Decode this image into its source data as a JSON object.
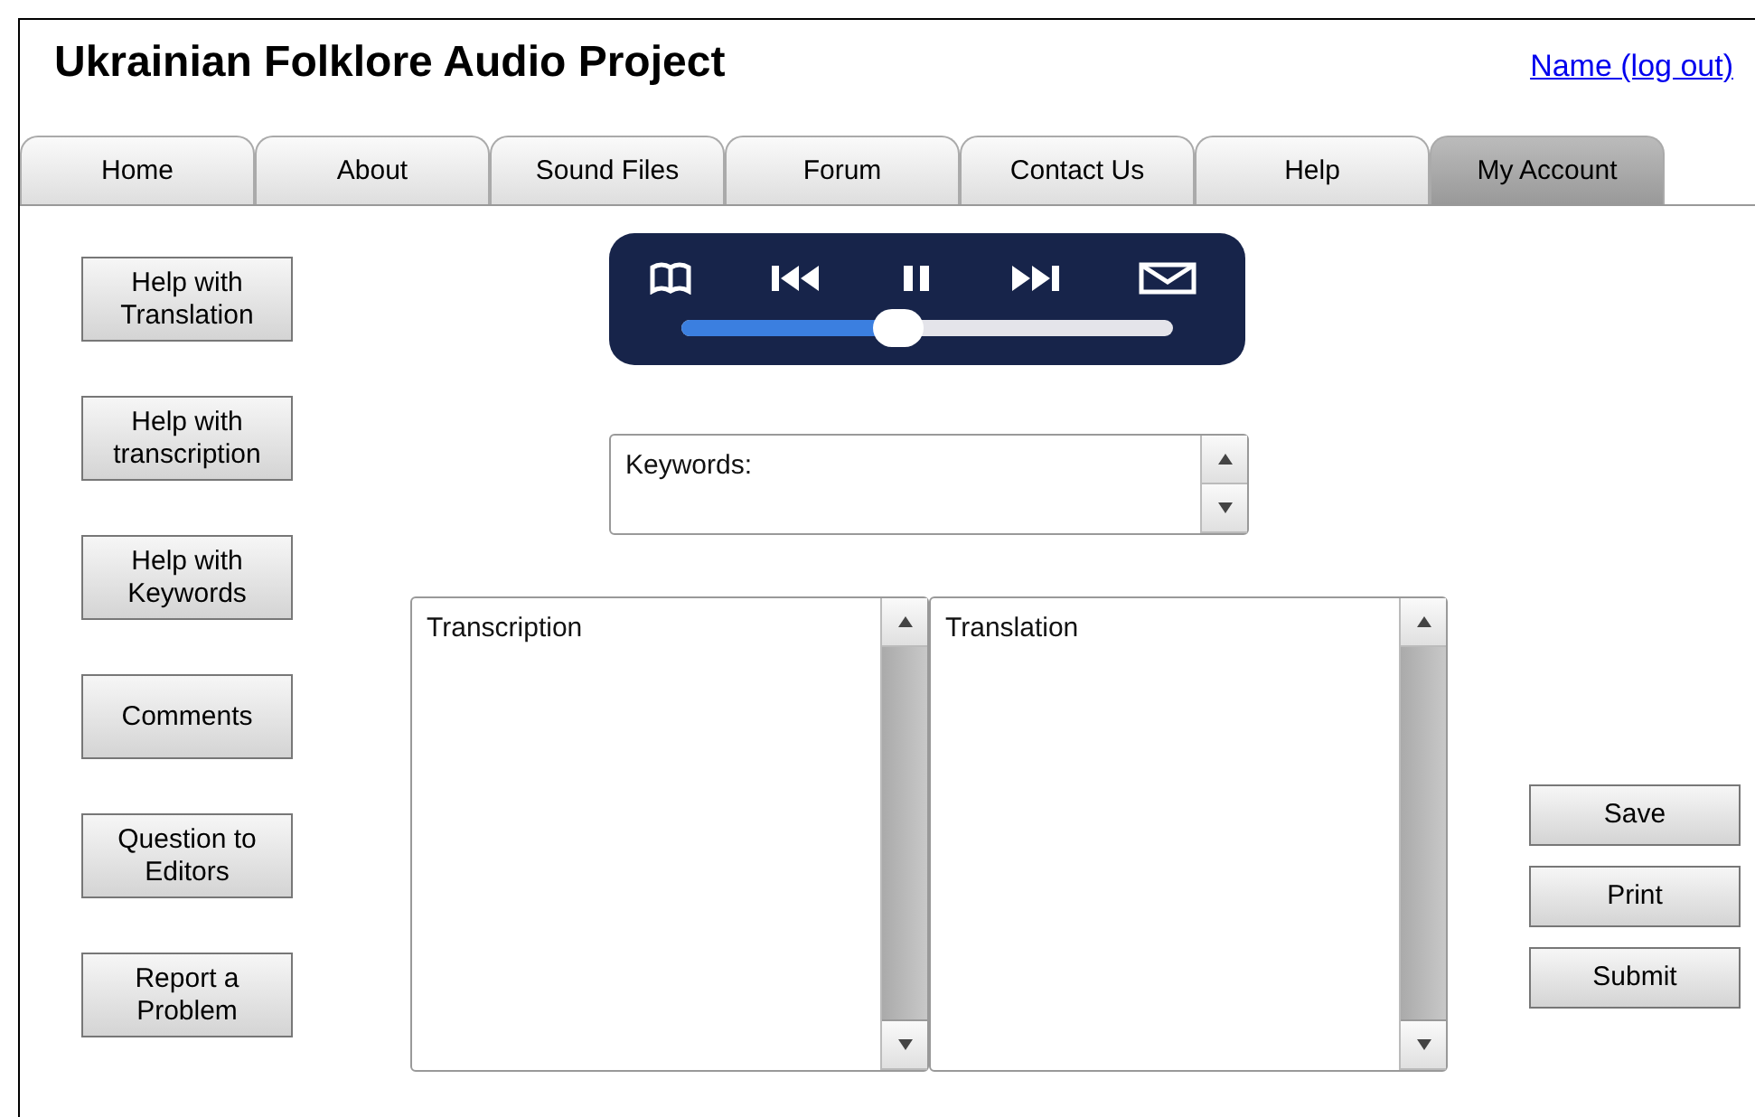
{
  "header": {
    "title": "Ukrainian Folklore Audio Project",
    "user_link": "Name (log out)"
  },
  "tabs": [
    {
      "label": "Home",
      "selected": false
    },
    {
      "label": "About",
      "selected": false
    },
    {
      "label": "Sound Files",
      "selected": false
    },
    {
      "label": "Forum",
      "selected": false
    },
    {
      "label": "Contact Us",
      "selected": false
    },
    {
      "label": "Help",
      "selected": false
    },
    {
      "label": "My Account",
      "selected": true
    }
  ],
  "side_buttons": [
    "Help with Translation",
    "Help with transcription",
    "Help with Keywords",
    "Comments",
    "Question to Editors",
    "Report a Problem"
  ],
  "player": {
    "level": 0.44
  },
  "keywords": {
    "value": "Keywords:"
  },
  "text_panes": [
    {
      "value": "Transcription"
    },
    {
      "value": "Translation"
    }
  ],
  "actions": [
    "Save",
    "Print",
    "Submit"
  ]
}
